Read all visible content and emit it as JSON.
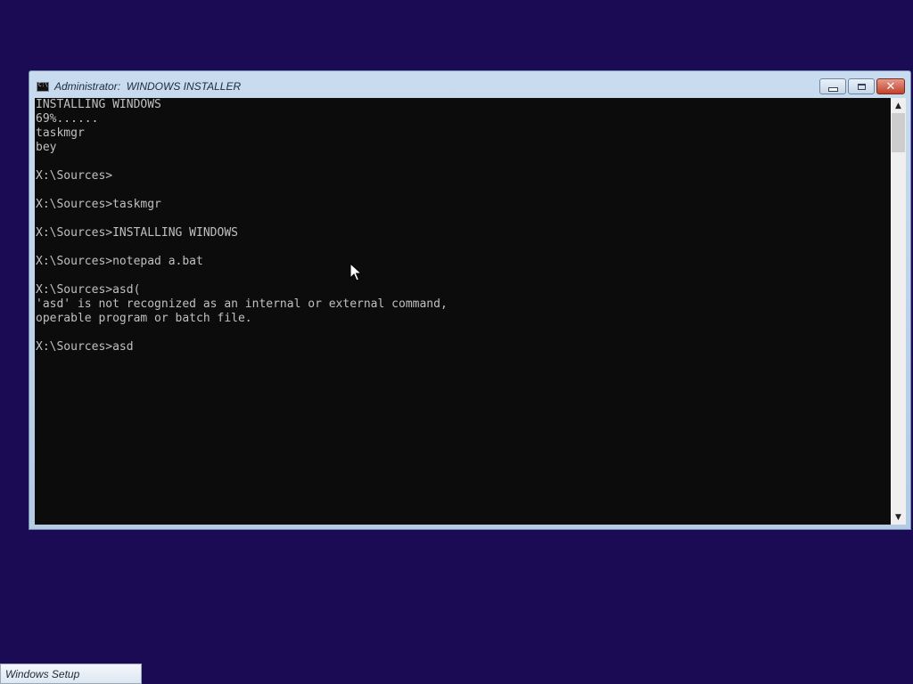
{
  "window": {
    "title": "Administrator:  WINDOWS INSTALLER",
    "buttons": {
      "minimize_icon": "minimize-icon",
      "maximize_icon": "maximize-icon",
      "close_icon": "close-icon",
      "close_glyph": "✕"
    }
  },
  "console": {
    "lines": [
      "INSTALLING WINDOWS",
      "69%......",
      "taskmgr",
      "bey",
      "",
      "X:\\Sources>",
      "",
      "X:\\Sources>taskmgr",
      "",
      "X:\\Sources>INSTALLING WINDOWS",
      "",
      "X:\\Sources>notepad a.bat",
      "",
      "X:\\Sources>asd(",
      "'asd' is not recognized as an internal or external command,",
      "operable program or batch file.",
      "",
      "X:\\Sources>asd"
    ]
  },
  "scrollbar": {
    "up_glyph": "▲",
    "down_glyph": "▼"
  },
  "taskbar": {
    "button_label": "Windows Setup"
  },
  "colors": {
    "desktop_background": "#1b0b54",
    "console_background": "#0c0c0c",
    "console_text": "#c0c0c0",
    "close_button": "#c3412b"
  }
}
